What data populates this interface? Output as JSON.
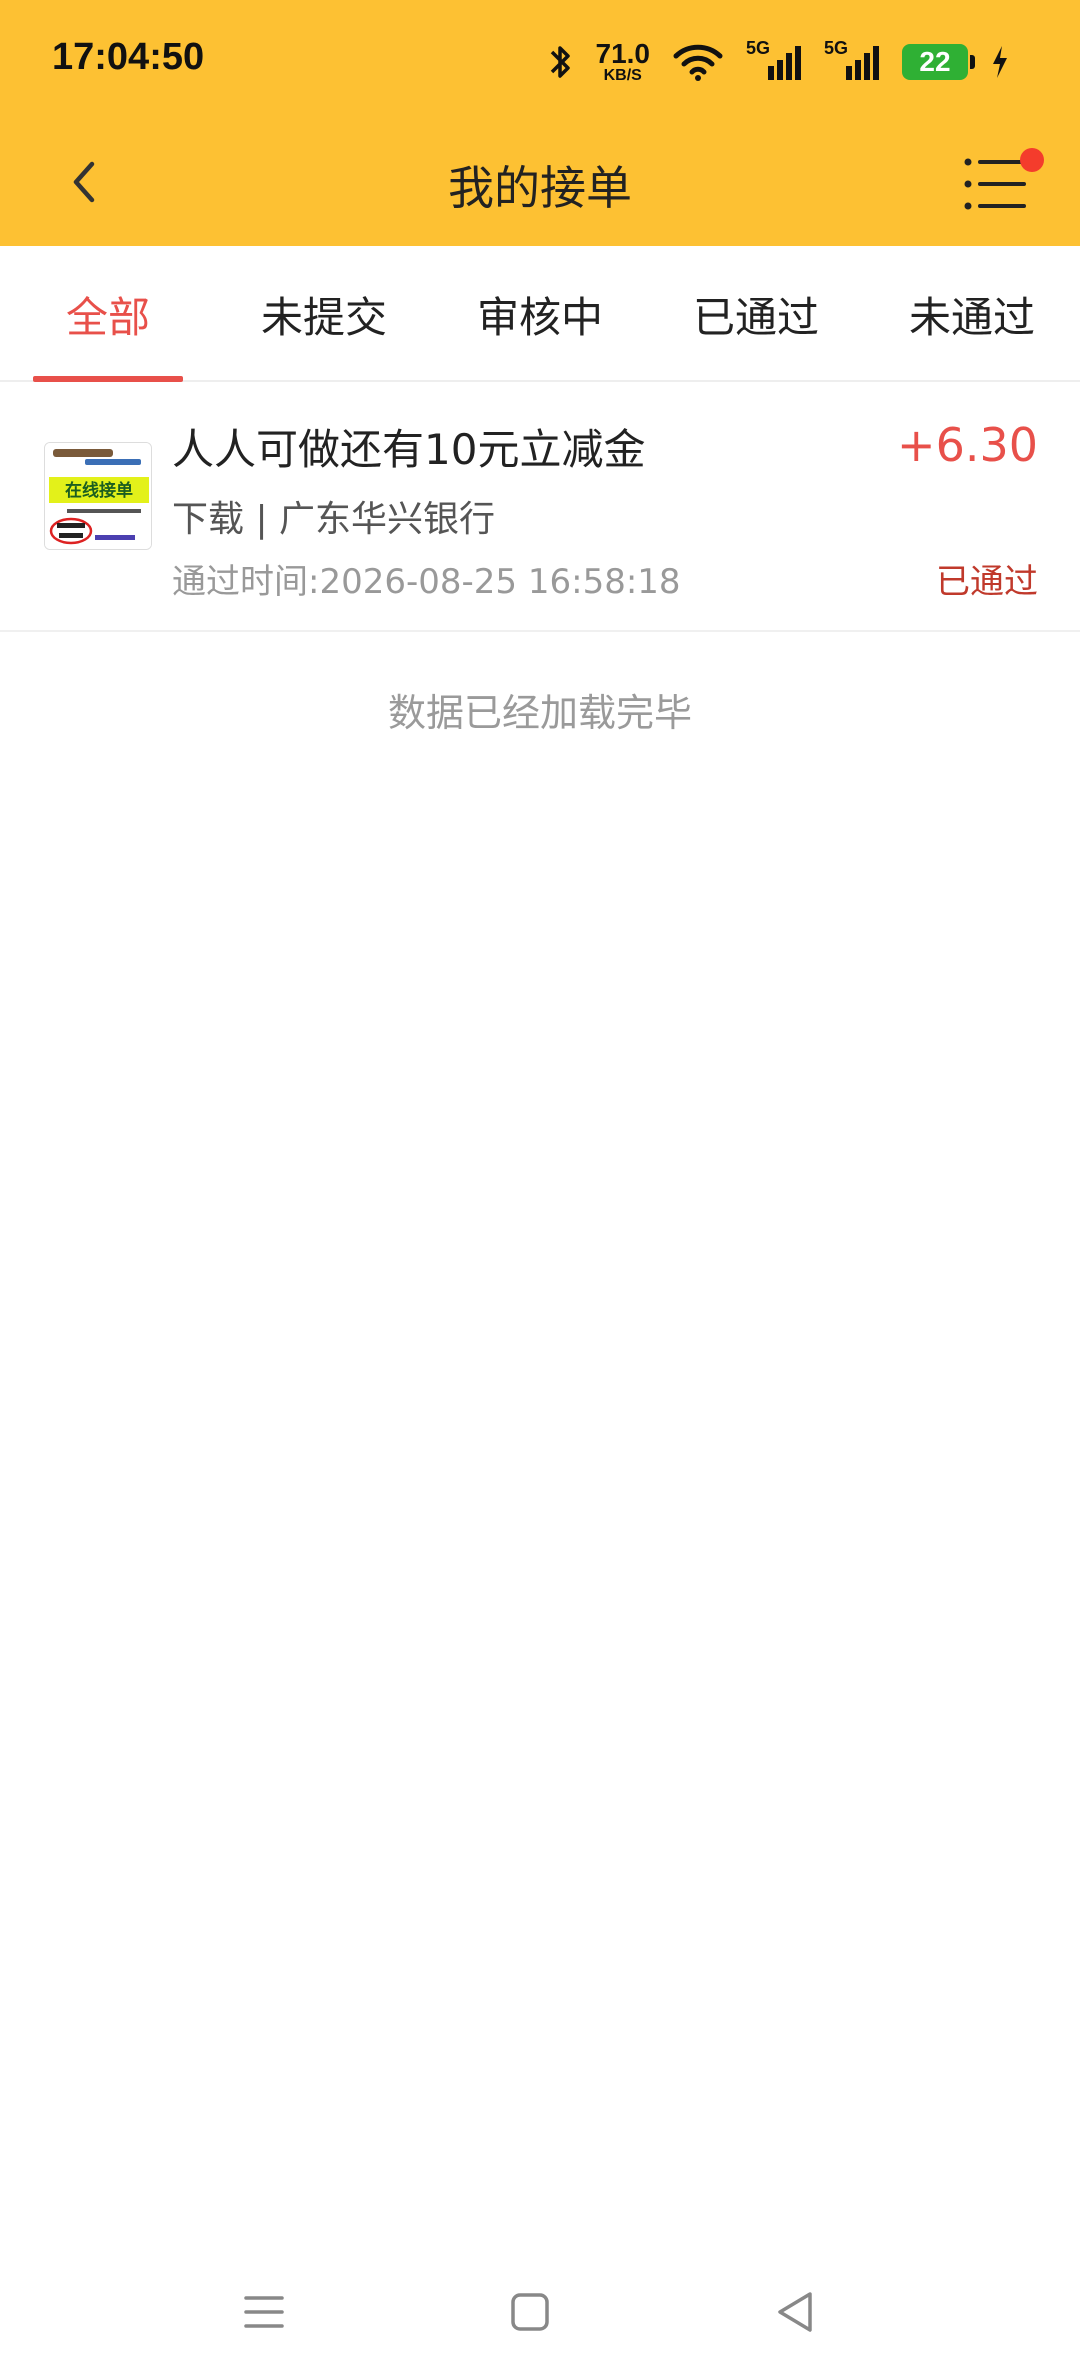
{
  "status_bar": {
    "time": "17:04:50",
    "net_speed_value": "71.0",
    "net_speed_unit": "KB/S",
    "signal_1_label": "5G",
    "signal_2_label": "5G",
    "battery": "22"
  },
  "nav": {
    "title": "我的接单"
  },
  "tabs": [
    {
      "label": "全部"
    },
    {
      "label": "未提交"
    },
    {
      "label": "审核中"
    },
    {
      "label": "已通过"
    },
    {
      "label": "未通过"
    }
  ],
  "orders": [
    {
      "title": "人人可做还有10元立减金",
      "subtitle": "下载 | 广东华兴银行",
      "time": "通过时间:2026-08-25 16:58:18",
      "amount": "+6.30",
      "status": "已通过",
      "thumb_text": "在线接单"
    }
  ],
  "footer_text": "数据已经加载完毕",
  "colors": {
    "header": "#FDC133",
    "accent": "#E8504A",
    "status": "#C0392B"
  }
}
